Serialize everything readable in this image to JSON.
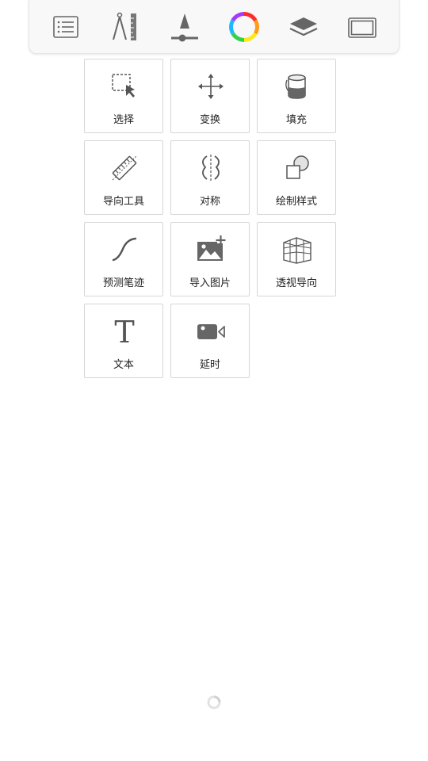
{
  "toolbar": {
    "buttons": [
      {
        "icon": "list-icon"
      },
      {
        "icon": "ruler-compass-icon"
      },
      {
        "icon": "brush-size-icon"
      },
      {
        "icon": "color-wheel-icon"
      },
      {
        "icon": "layers-icon"
      },
      {
        "icon": "canvas-frame-icon"
      }
    ]
  },
  "tools": [
    {
      "label": "选择",
      "icon": "selection-icon"
    },
    {
      "label": "变换",
      "icon": "move-transform-icon"
    },
    {
      "label": "填充",
      "icon": "fill-bucket-icon"
    },
    {
      "label": "导向工具",
      "icon": "ruler-guide-icon"
    },
    {
      "label": "对称",
      "icon": "symmetry-icon"
    },
    {
      "label": "绘制样式",
      "icon": "shape-style-icon"
    },
    {
      "label": "预测笔迹",
      "icon": "predictive-stroke-icon"
    },
    {
      "label": "导入图片",
      "icon": "import-image-icon"
    },
    {
      "label": "透视导向",
      "icon": "perspective-guide-icon"
    },
    {
      "label": "文本",
      "icon": "text-icon"
    },
    {
      "label": "延时",
      "icon": "timelapse-camera-icon"
    }
  ],
  "colors": {
    "icon": "#555555",
    "tile_border": "#d6d6d6",
    "toolbar_bg": "#f8f8f8"
  }
}
